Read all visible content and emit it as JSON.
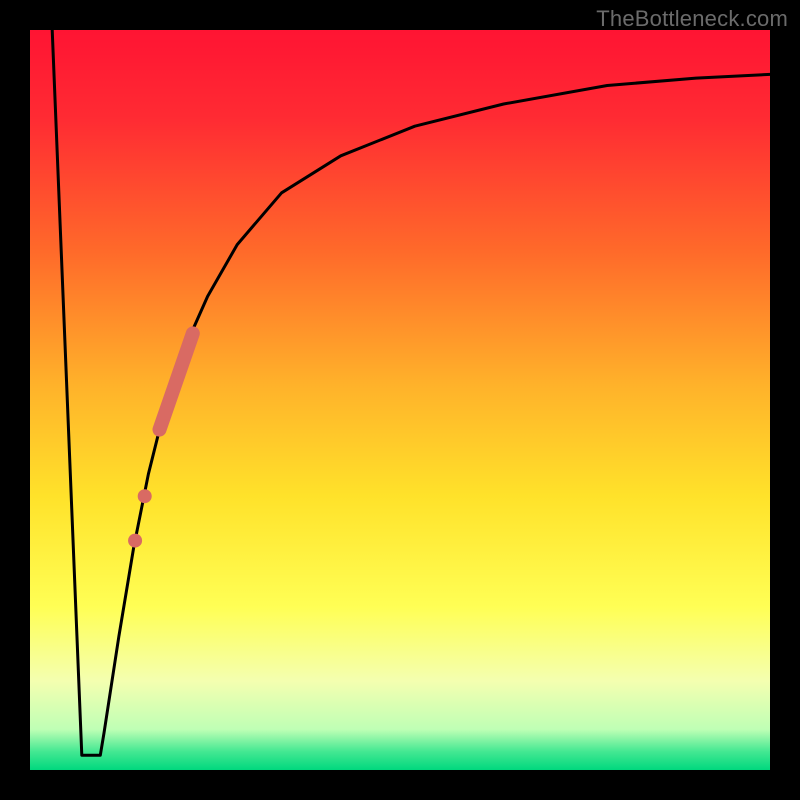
{
  "watermark": "TheBottleneck.com",
  "colors": {
    "frame": "#000000",
    "curve": "#000000",
    "marker": "#d96a63",
    "gradient_stops": [
      {
        "offset": 0.0,
        "color": "#ff1433"
      },
      {
        "offset": 0.12,
        "color": "#ff2b33"
      },
      {
        "offset": 0.3,
        "color": "#ff6a2a"
      },
      {
        "offset": 0.48,
        "color": "#ffb22a"
      },
      {
        "offset": 0.63,
        "color": "#ffe22a"
      },
      {
        "offset": 0.78,
        "color": "#ffff55"
      },
      {
        "offset": 0.88,
        "color": "#f4ffb0"
      },
      {
        "offset": 0.945,
        "color": "#bfffb5"
      },
      {
        "offset": 0.975,
        "color": "#44e892"
      },
      {
        "offset": 1.0,
        "color": "#00d87e"
      }
    ]
  },
  "chart_data": {
    "type": "line",
    "title": "",
    "xlabel": "",
    "ylabel": "",
    "xlim": [
      0,
      100
    ],
    "ylim": [
      0,
      100
    ],
    "series": [
      {
        "name": "bottleneck-curve",
        "x": [
          3.0,
          5.0,
          6.0,
          7.5,
          9.0,
          10.0,
          12.0,
          14.0,
          16.0,
          18.0,
          20.0,
          24.0,
          28.0,
          34.0,
          42.0,
          52.0,
          64.0,
          78.0,
          90.0,
          100.0
        ],
        "y": [
          100,
          50,
          12,
          2,
          2,
          5,
          18,
          30,
          40,
          48,
          55,
          64,
          71,
          78,
          83,
          87,
          90,
          92.5,
          93.5,
          94
        ]
      }
    ],
    "flat_bottom": {
      "x_start": 7.0,
      "x_end": 9.5,
      "y": 2
    },
    "markers": [
      {
        "name": "highlight-segment",
        "type": "segment",
        "x_start": 17.5,
        "y_start": 46,
        "x_end": 22.0,
        "y_end": 59,
        "width": 14
      },
      {
        "name": "dot-lower-1",
        "type": "dot",
        "x": 15.5,
        "y": 37,
        "r": 7
      },
      {
        "name": "dot-lower-2",
        "type": "dot",
        "x": 14.2,
        "y": 31,
        "r": 7
      }
    ]
  }
}
